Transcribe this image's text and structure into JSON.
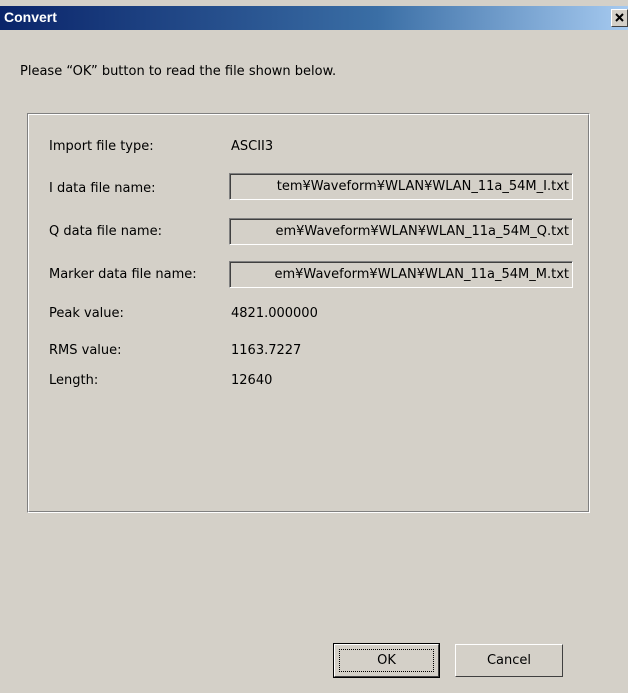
{
  "window": {
    "title": "Convert",
    "close_glyph": "×"
  },
  "instruction": "Please “OK” button to read the file shown below.",
  "info": {
    "import_type_label": "Import file type:",
    "import_type_value": "ASCII3",
    "i_file_label": "I data file name:",
    "i_file_value": "tem¥Waveform¥WLAN¥WLAN_11a_54M_I.txt",
    "q_file_label": "Q data file name:",
    "q_file_value": "em¥Waveform¥WLAN¥WLAN_11a_54M_Q.txt",
    "marker_file_label": "Marker data file name:",
    "marker_file_value": "em¥Waveform¥WLAN¥WLAN_11a_54M_M.txt",
    "peak_label": "Peak value:",
    "peak_value": "4821.000000",
    "rms_label": "RMS value:",
    "rms_value": "1163.7227",
    "length_label": "Length:",
    "length_value": "12640"
  },
  "buttons": {
    "ok": "OK",
    "cancel": "Cancel"
  },
  "colors": {
    "face": "#d4d0c8",
    "title_start": "#0a246a",
    "title_end": "#a6caf0"
  }
}
